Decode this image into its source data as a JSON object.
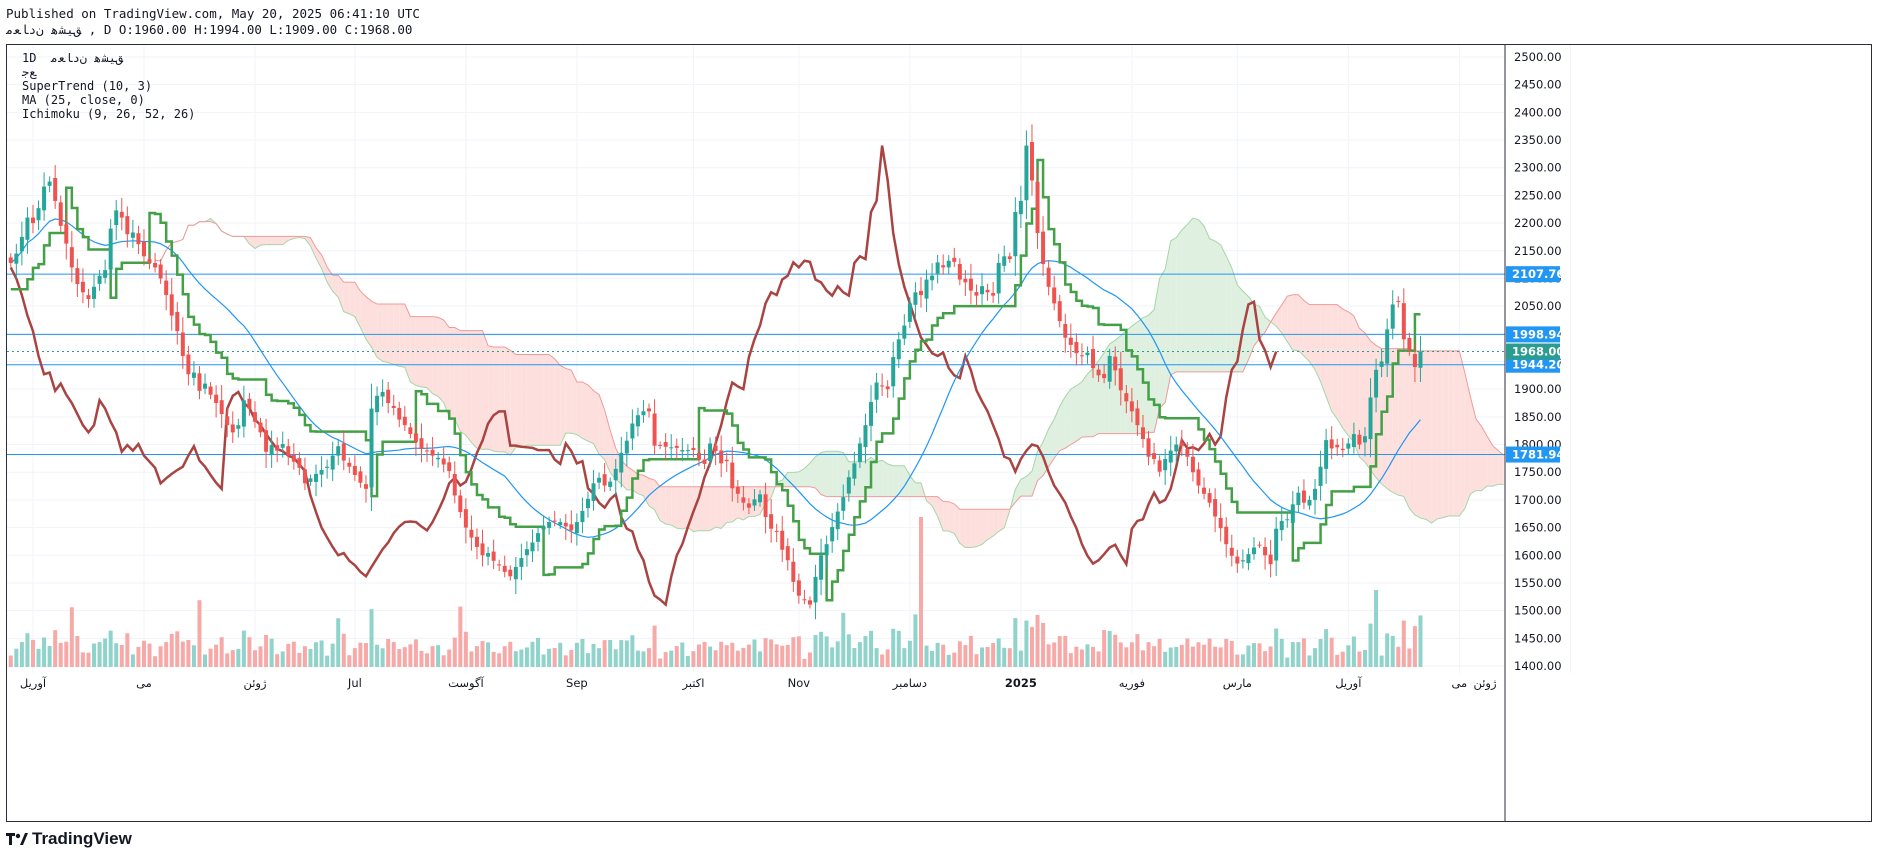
{
  "header": {
    "published": "Published on TradingView.com, May 20, 2025 06:41:10 UTC",
    "ohlc_line": "ﻖﯿﺸﻫ ﻥﺩﺎﻌﻣ , D O:1960.00 H:1994.00 L:1909.00 C:1968.00"
  },
  "legend": {
    "symbol": "1D  ﻖﯿﺸﻫ ﻥﺩﺎﻌﻣ",
    "exchange": "ﻊﺟ",
    "supertrend": "SuperTrend (10, 3)",
    "ma": "MA (25, close, 0)",
    "ichimoku": "Ichimoku (9, 26, 52, 26)"
  },
  "brand": {
    "name": "TradingView"
  },
  "colors": {
    "up": "#26a69a",
    "down": "#ef5350",
    "up_volume": "#8fd3cb",
    "down_volume": "#f7a9a7",
    "supertrend": "#43a047",
    "lagging": "#a94442",
    "ma": "#2196f3",
    "cloud_bull": "#dfefe0",
    "cloud_bear": "#fde0dd",
    "hline": "#2196f3",
    "last_price": "#2a9d8f"
  },
  "chart_data": {
    "type": "candlestick",
    "price_axis": {
      "ticks": [
        2500,
        2450,
        2400,
        2350,
        2300,
        2250,
        2200,
        2150,
        2100,
        2050,
        2000,
        1950,
        1900,
        1850,
        1800,
        1750,
        1700,
        1650,
        1600,
        1550,
        1500,
        1450,
        1400
      ]
    },
    "ylim": [
      1390,
      2520
    ],
    "time_axis": {
      "labels": [
        "آوریل",
        "می",
        "ژوئن",
        "Jul",
        "آگوست",
        "Sep",
        "اکتبر",
        "Nov",
        "دسامبر",
        "2025",
        "فوریه",
        "مارس",
        "آوریل",
        "می",
        "ژوئن"
      ],
      "label_at_candle": [
        4,
        24,
        44,
        62,
        82,
        102,
        123,
        142,
        162,
        182,
        202,
        221,
        241,
        261,
        281
      ]
    },
    "horizontal_levels": [
      2107.76,
      1998.94,
      1944.2,
      1781.94
    ],
    "last_price": 1968.0,
    "closes": [
      2128,
      2145,
      2175,
      2210,
      2200,
      2227,
      2266,
      2275,
      2240,
      2195,
      2163,
      2120,
      2090,
      2075,
      2063,
      2085,
      2105,
      2115,
      2190,
      2223,
      2210,
      2180,
      2183,
      2162,
      2140,
      2128,
      2120,
      2100,
      2070,
      2033,
      2005,
      1960,
      1927,
      1930,
      1897,
      1910,
      1890,
      1875,
      1855,
      1835,
      1822,
      1835,
      1880,
      1865,
      1841,
      1822,
      1787,
      1799,
      1789,
      1801,
      1780,
      1769,
      1758,
      1730,
      1739,
      1747,
      1754,
      1760,
      1780,
      1797,
      1771,
      1760,
      1745,
      1731,
      1720,
      1865,
      1888,
      1895,
      1875,
      1866,
      1845,
      1835,
      1819,
      1805,
      1792,
      1788,
      1780,
      1776,
      1764,
      1752,
      1708,
      1678,
      1650,
      1632,
      1615,
      1600,
      1604,
      1590,
      1582,
      1570,
      1562,
      1579,
      1595,
      1611,
      1623,
      1640,
      1652,
      1660,
      1661,
      1660,
      1652,
      1645,
      1660,
      1680,
      1702,
      1730,
      1740,
      1726,
      1733,
      1756,
      1785,
      1807,
      1838,
      1853,
      1860,
      1860,
      1798,
      1798,
      1796,
      1795,
      1794,
      1790,
      1790,
      1790,
      1773,
      1765,
      1802,
      1788,
      1766,
      1770,
      1721,
      1711,
      1695,
      1686,
      1701,
      1710,
      1669,
      1648,
      1643,
      1610,
      1591,
      1552,
      1527,
      1520,
      1511,
      1561,
      1600,
      1620,
      1651,
      1679,
      1705,
      1741,
      1766,
      1802,
      1835,
      1877,
      1912,
      1905,
      1900,
      1958,
      1990,
      2015,
      2055,
      2075,
      2070,
      2098,
      2105,
      2129,
      2120,
      2132,
      2130,
      2098,
      2093,
      2078,
      2069,
      2086,
      2075,
      2069,
      2128,
      2140,
      2135,
      2220,
      2240,
      2340,
      2277,
      2182,
      2126,
      2085,
      2055,
      2023,
      1993,
      1980,
      1965,
      1960,
      1966,
      1938,
      1925,
      1920,
      1960,
      1934,
      1898,
      1878,
      1860,
      1835,
      1810,
      1778,
      1774,
      1751,
      1774,
      1789,
      1800,
      1797,
      1778,
      1750,
      1726,
      1711,
      1695,
      1670,
      1649,
      1620,
      1599,
      1585,
      1591,
      1602,
      1614,
      1619,
      1600,
      1584,
      1648,
      1662,
      1665,
      1692,
      1713,
      1695,
      1700,
      1720,
      1760,
      1808,
      1793,
      1795,
      1790,
      1802,
      1819,
      1800,
      1815,
      1885,
      1935,
      1950,
      2008,
      2053,
      2058,
      1990,
      1970,
      1940,
      1968
    ]
  }
}
